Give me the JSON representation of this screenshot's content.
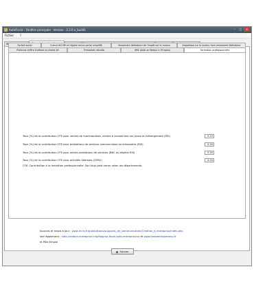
{
  "window": {
    "title": "AutoFiscta - Fenêtre principale - Version : 2.2.0.a_build1",
    "minimize": "–",
    "maximize": "□",
    "close": "✕"
  },
  "menu": {
    "file": "Fichier",
    "help": "?"
  },
  "tabs": [
    {
      "label": "Statut entreprise",
      "state": "normal"
    },
    {
      "label": "Taux et données légaux",
      "state": "active"
    },
    {
      "label": "Connexion",
      "state": "normal"
    },
    {
      "label": "Connexion (hors du module de la base Impôt.Info)",
      "state": "disabled"
    },
    {
      "label": "Régime",
      "state": "normal"
    },
    {
      "label": "Droits et Charges",
      "state": "normal"
    }
  ],
  "subtabs_row1": [
    {
      "label": "Forfait social"
    },
    {
      "label": "Cumul ACCRE et régime micro-social simplifié"
    },
    {
      "label": "Versement libératoire de l'impôt sur le revenu"
    },
    {
      "label": "Imposition sur le revenu hors versement libératoire"
    }
  ],
  "subtabs_row2": [
    {
      "label": "Plafonds chiffre d'affaire du statut AE"
    },
    {
      "label": "Trimestres retraite"
    },
    {
      "label": "ARE (Aide au Retour à l'Emploi)"
    },
    {
      "label": "Formation professionnelle",
      "active": true
    }
  ],
  "rates": [
    {
      "label": "Taux (%) de la contribution CFE pour ventes de marchandises, ventes à consommer sur place ou hébergement  (RSI)",
      "value": "0.10"
    },
    {
      "label": "Taux (%) de la contribution CFE pour prestations de services commerciales ou artisanales (RSI)",
      "value": "0.30"
    },
    {
      "label": "Taux (%) de la contribution CFE pour autres prestations de services (BNC du régime RSI)",
      "value": "0.30"
    },
    {
      "label": "Taux (%) de la contribution CFE pour activités libérales (CIPAV)",
      "value": "0.20"
    }
  ],
  "note": "CFE: Contribution à la formation professionnelle. Son taux peut varier selon les départements.",
  "sources": {
    "line1_prefix": "Sources et mises à jour :",
    "line1_link": "www.le-rsi.fr/publications/supports_de_communication/Creation_d_entreprise/index.php",
    "line2_prefix": "Voir également :",
    "line2_link1": "aide-creation-entreprise.info/Regime-fiscal-auto-entrepreneur",
    "line2_mid": "et",
    "line2_link2": "www.lautoentrepreneur.fr",
    "line3": "et Pôle Emploi"
  },
  "save_button": "Sauver"
}
